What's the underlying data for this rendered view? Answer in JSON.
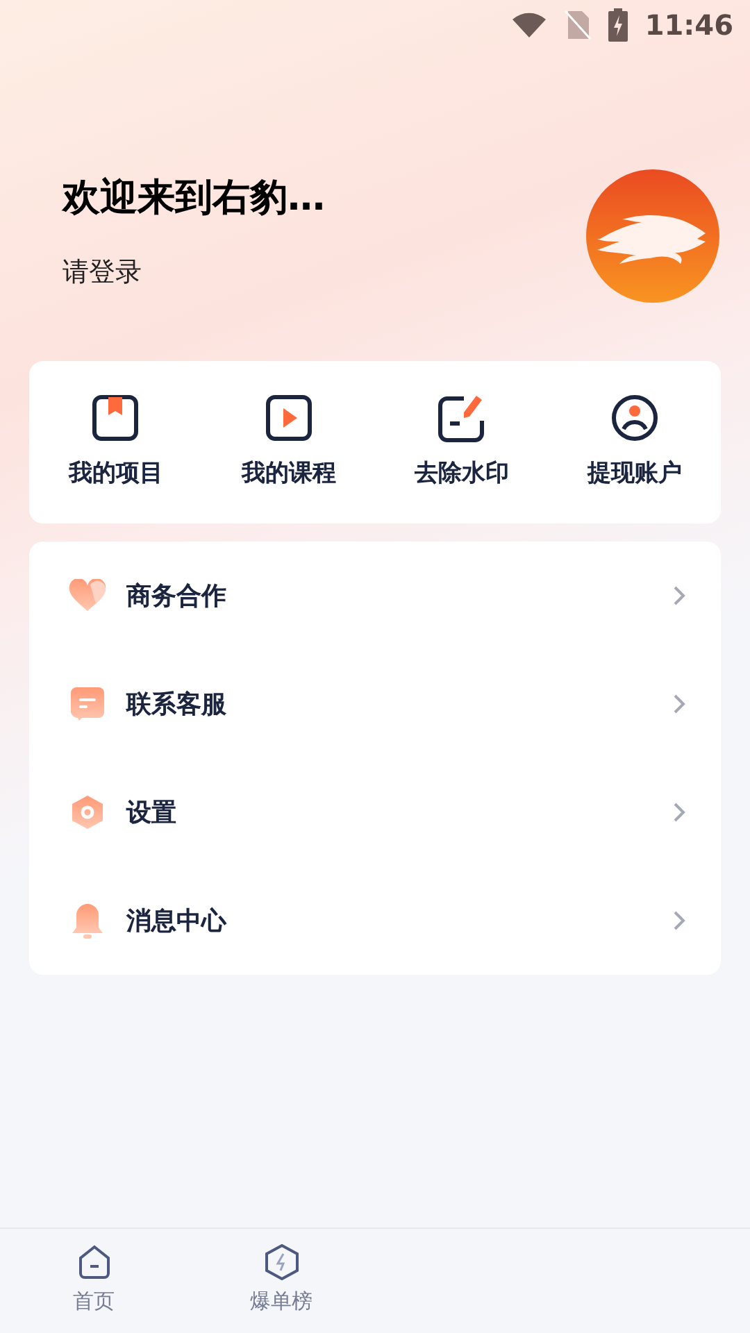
{
  "status_bar": {
    "time": "11:46"
  },
  "header": {
    "title": "欢迎来到右豹…",
    "subtitle": "请登录"
  },
  "shortcuts": [
    {
      "label": "我的项目"
    },
    {
      "label": "我的课程"
    },
    {
      "label": "去除水印"
    },
    {
      "label": "提现账户"
    }
  ],
  "menu": [
    {
      "label": "商务合作"
    },
    {
      "label": "联系客服"
    },
    {
      "label": "设置"
    },
    {
      "label": "消息中心"
    }
  ],
  "tab_bar": [
    {
      "label": "首页",
      "selected": false
    },
    {
      "label": "爆单榜",
      "selected": false
    }
  ]
}
